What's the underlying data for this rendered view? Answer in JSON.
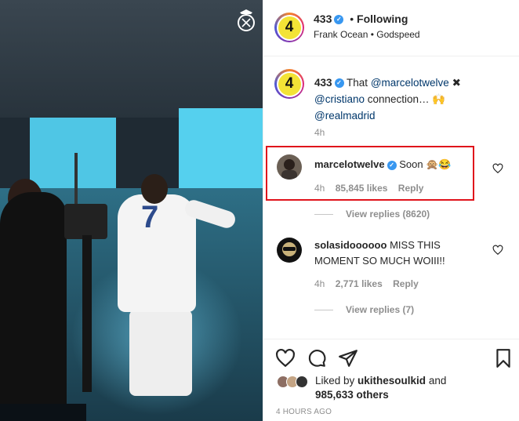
{
  "header": {
    "username": "433",
    "separator": "•",
    "follow_label": "Following",
    "subtitle": "Frank Ocean • Godspeed",
    "avatar_text": "4"
  },
  "caption": {
    "username": "433",
    "text_intro": "That ",
    "mention1": "@marcelotwelve",
    "emoji1": "✖",
    "mention2": "@cristiano",
    "text_mid": " connection… ",
    "emoji2": "🙌",
    "mention3": "@realmadrid",
    "time": "4h"
  },
  "comments": [
    {
      "username": "marcelotwelve",
      "text": "Soon 🙊😂",
      "time": "4h",
      "likes": "85,845 likes",
      "reply_label": "Reply",
      "view_replies": "View replies (8620)"
    },
    {
      "username": "solasidoooooo",
      "text": "MISS THIS MOMENT SO MUCH WOIII!!",
      "time": "4h",
      "likes": "2,771 likes",
      "reply_label": "Reply",
      "view_replies": "View replies (7)"
    }
  ],
  "likes": {
    "liked_by_prefix": "Liked by ",
    "liked_by_user": "ukithesoulkid",
    "and_label": " and",
    "others": "985,633 others"
  },
  "timestamp": "4 HOURS AGO",
  "media": {
    "jersey_number": "7"
  },
  "colors": {
    "verified": "#3897f0",
    "highlight": "#e0131b",
    "link": "#00376b",
    "meta": "#8e8e8e"
  }
}
